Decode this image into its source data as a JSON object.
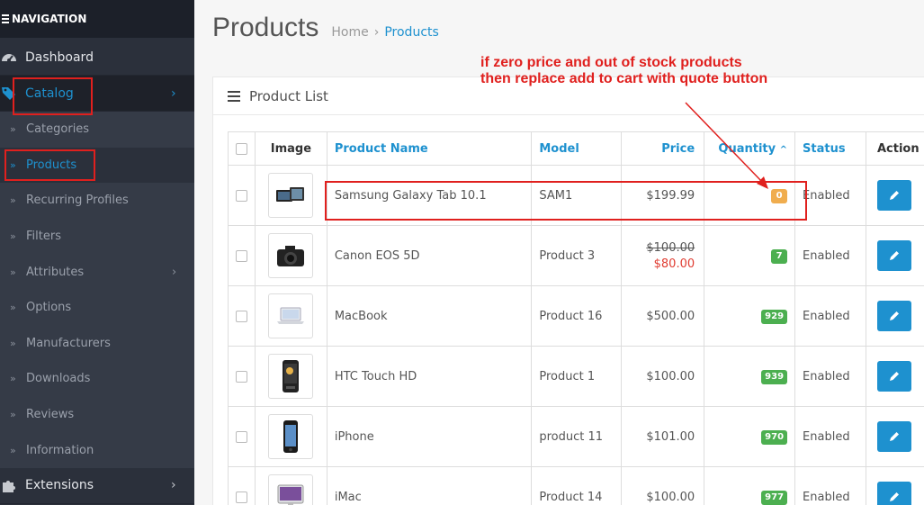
{
  "sidebar": {
    "header": "NAVIGATION",
    "dashboard": "Dashboard",
    "catalog": "Catalog",
    "submenu": [
      {
        "label": "Categories",
        "has_children": false,
        "active": false
      },
      {
        "label": "Products",
        "has_children": false,
        "active": true
      },
      {
        "label": "Recurring Profiles",
        "has_children": false,
        "active": false
      },
      {
        "label": "Filters",
        "has_children": false,
        "active": false
      },
      {
        "label": "Attributes",
        "has_children": true,
        "active": false
      },
      {
        "label": "Options",
        "has_children": false,
        "active": false
      },
      {
        "label": "Manufacturers",
        "has_children": false,
        "active": false
      },
      {
        "label": "Downloads",
        "has_children": false,
        "active": false
      },
      {
        "label": "Reviews",
        "has_children": false,
        "active": false
      },
      {
        "label": "Information",
        "has_children": false,
        "active": false
      }
    ],
    "extensions": "Extensions"
  },
  "page": {
    "title": "Products",
    "breadcrumb": [
      "Home",
      "Products"
    ]
  },
  "panel": {
    "title": "Product List"
  },
  "table": {
    "headers": {
      "image": "Image",
      "name": "Product Name",
      "model": "Model",
      "price": "Price",
      "quantity": "Quantity",
      "status": "Status",
      "action": "Action"
    },
    "rows": [
      {
        "name": "Samsung Galaxy Tab 10.1",
        "model": "SAM1",
        "price": "$199.99",
        "special": "",
        "quantity": "0",
        "qty_state": "warning",
        "status": "Enabled",
        "image": "tablet"
      },
      {
        "name": "Canon EOS 5D",
        "model": "Product 3",
        "price": "$100.00",
        "special": "$80.00",
        "quantity": "7",
        "qty_state": "success",
        "status": "Enabled",
        "image": "camera"
      },
      {
        "name": "MacBook",
        "model": "Product 16",
        "price": "$500.00",
        "special": "",
        "quantity": "929",
        "qty_state": "success",
        "status": "Enabled",
        "image": "laptop"
      },
      {
        "name": "HTC Touch HD",
        "model": "Product 1",
        "price": "$100.00",
        "special": "",
        "quantity": "939",
        "qty_state": "success",
        "status": "Enabled",
        "image": "phone"
      },
      {
        "name": "iPhone",
        "model": "product 11",
        "price": "$101.00",
        "special": "",
        "quantity": "970",
        "qty_state": "success",
        "status": "Enabled",
        "image": "iphone"
      },
      {
        "name": "iMac",
        "model": "Product 14",
        "price": "$100.00",
        "special": "",
        "quantity": "977",
        "qty_state": "success",
        "status": "Enabled",
        "image": "imac"
      }
    ]
  },
  "annotation": {
    "line1": "if zero price and out of stock products",
    "line2": "then replace add to cart with quote button"
  },
  "colors": {
    "accent": "#1e91cf",
    "sidebar": "#2b303b",
    "annotation": "#e0201e",
    "badge_warning": "#f0ad4e",
    "badge_success": "#4caf50"
  }
}
